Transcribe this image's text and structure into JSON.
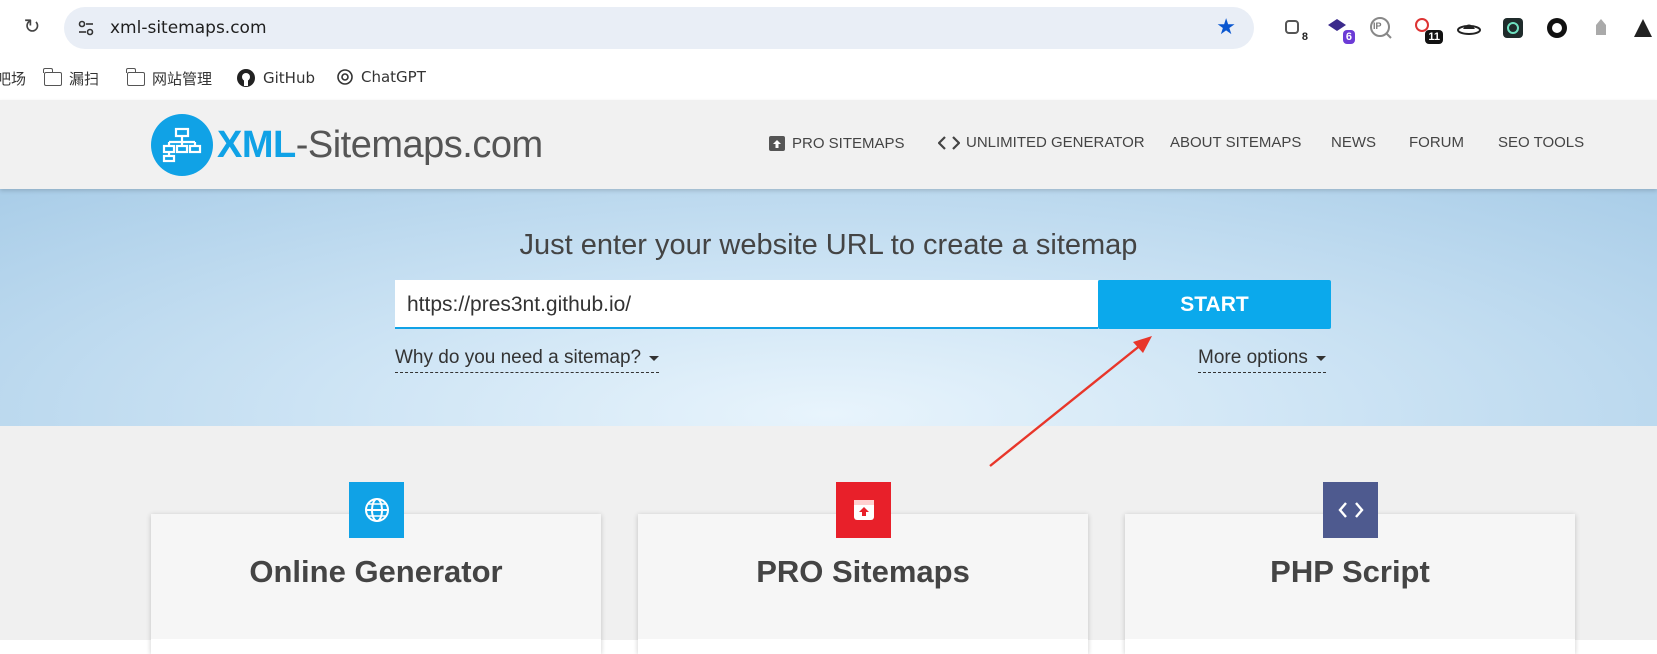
{
  "browser": {
    "url": "xml-sitemaps.com",
    "extensions": [
      {
        "name": "extension-icon-1",
        "badge": "8"
      },
      {
        "name": "extension-icon-2",
        "badge": "6"
      },
      {
        "name": "ip-extension-icon",
        "label": "IP"
      },
      {
        "name": "extension-icon-4",
        "badge": "11"
      },
      {
        "name": "extension-icon-5"
      },
      {
        "name": "extension-icon-6"
      },
      {
        "name": "extension-icon-7"
      },
      {
        "name": "extension-icon-8"
      },
      {
        "name": "extension-icon-9"
      }
    ]
  },
  "bookmarks": {
    "items": [
      {
        "label": "吧场",
        "icon": "text"
      },
      {
        "label": "漏扫",
        "icon": "folder-icon"
      },
      {
        "label": "网站管理",
        "icon": "folder-icon"
      },
      {
        "label": "GitHub",
        "icon": "github-icon"
      },
      {
        "label": "ChatGPT",
        "icon": "chatgpt-icon"
      }
    ]
  },
  "site": {
    "logo_xml": "XML",
    "logo_rest": "-Sitemaps.com",
    "nav": [
      {
        "label": "PRO SITEMAPS",
        "icon": "pro-icon"
      },
      {
        "label": "UNLIMITED GENERATOR",
        "icon": "code-icon"
      },
      {
        "label": "ABOUT SITEMAPS"
      },
      {
        "label": "NEWS"
      },
      {
        "label": "FORUM"
      },
      {
        "label": "SEO TOOLS"
      }
    ]
  },
  "hero": {
    "title": "Just enter your website URL to create a sitemap",
    "url_value": "https://pres3nt.github.io/",
    "start_label": "START",
    "why_label": "Why do you need a sitemap?",
    "more_label": "More options"
  },
  "cards": [
    {
      "title": "Online Generator",
      "icon": "globe-icon",
      "color": "#10a2e6"
    },
    {
      "title": "PRO Sitemaps",
      "icon": "upload-box-icon",
      "color": "#e8202a"
    },
    {
      "title": "PHP Script",
      "icon": "code-icon",
      "color": "#4e5a8f"
    }
  ],
  "colors": {
    "brand_blue": "#10a2e6",
    "start_button": "#0ba9ec",
    "annotation_arrow": "#e8362a"
  }
}
